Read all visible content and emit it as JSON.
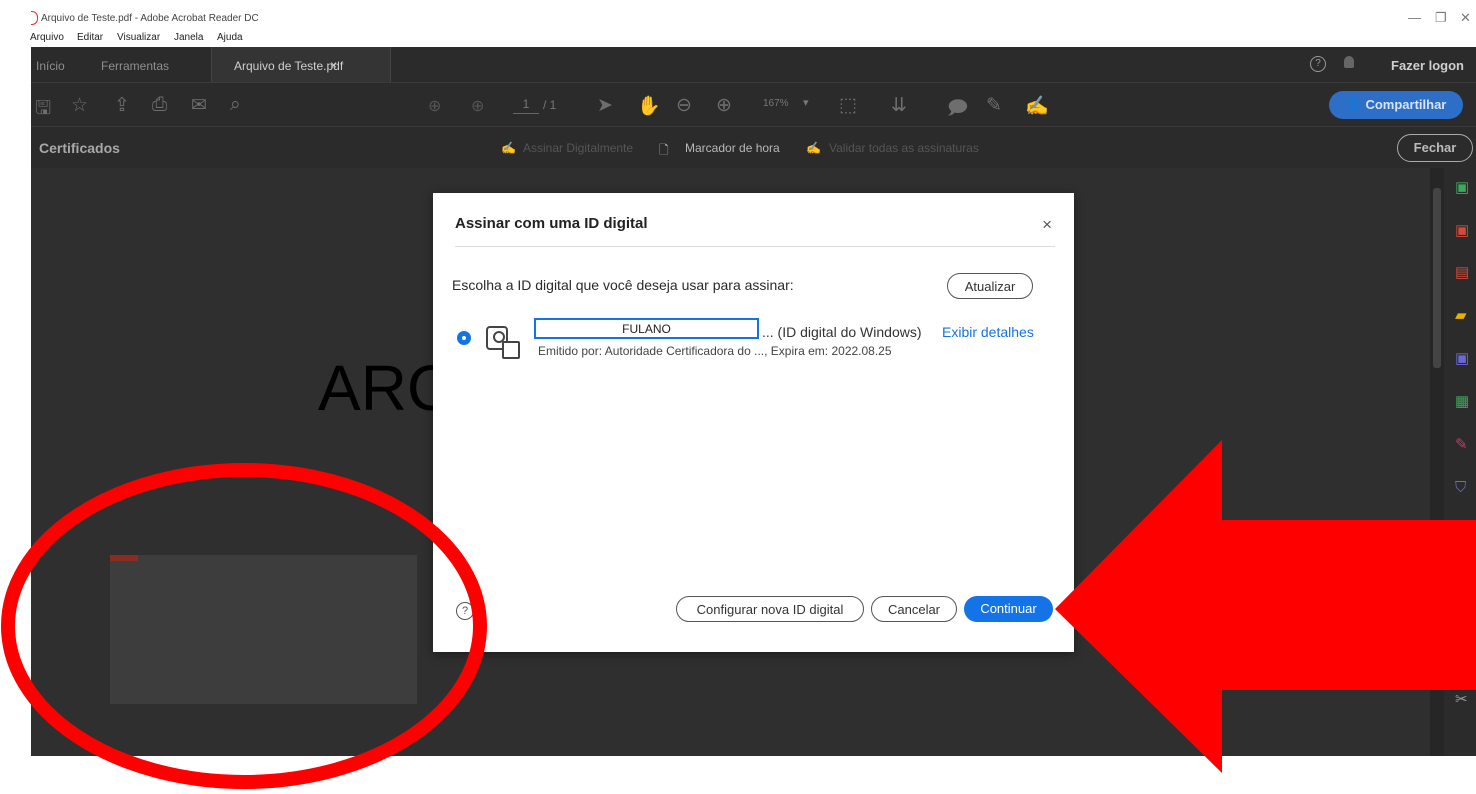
{
  "window": {
    "title": "Arquivo de Teste.pdf - Adobe Acrobat Reader DC",
    "minimize_glyph": "—",
    "restore_glyph": "❐",
    "close_glyph": "✕"
  },
  "menu": [
    "Arquivo",
    "Editar",
    "Visualizar",
    "Janela",
    "Ajuda"
  ],
  "tabs": {
    "inicio": "Início",
    "ferramentas": "Ferramentas",
    "document": "Arquivo de Teste.pdf",
    "document_close": "×",
    "login": "Fazer logon",
    "help_glyph": "?"
  },
  "toolbar": {
    "page_current": "1",
    "page_total": "/ 1",
    "zoom": "167%",
    "share": "Compartilhar"
  },
  "cert_bar": {
    "title": "Certificados",
    "sign": "Assinar Digitalmente",
    "timestamp": "Marcador de hora",
    "validate": "Validar todas as assinaturas",
    "close": "Fechar"
  },
  "document": {
    "visible_text": "ARC"
  },
  "dialog": {
    "title": "Assinar com uma ID digital",
    "close_glyph": "×",
    "prompt": "Escolha a ID digital que você deseja usar para assinar:",
    "refresh": "Atualizar",
    "id_name": "FULANO",
    "id_type": "... (ID digital do Windows)",
    "show_details": "Exibir detalhes",
    "issuer_line": "Emitido por: Autoridade Certificadora do ..., Expira em: 2022.08.25",
    "help_glyph": "?",
    "configure": "Configurar nova ID digital",
    "cancel": "Cancelar",
    "continue": "Continuar"
  },
  "colors": {
    "accent": "#1473e6",
    "share": "#2d6fc7",
    "annotation": "#ff0000",
    "chrome": "#2b2b2b",
    "canvas": "#2f2f2f"
  },
  "icons": {
    "toolbar": [
      "save-icon",
      "bookmark-star-icon",
      "upload-icon",
      "print-icon",
      "email-icon",
      "search-zoom-icon",
      "previous-page-icon",
      "next-page-icon",
      "select-cursor-icon",
      "hand-icon",
      "zoom-out-icon",
      "zoom-in-icon",
      "fit-page-icon",
      "scroll-mode-icon",
      "comment-icon",
      "highlight-pen-icon",
      "sign-icon"
    ],
    "right_rail": [
      "create-pdf-icon",
      "export-pdf-icon",
      "organize-pages-icon",
      "comment-tool-icon",
      "combine-files-icon",
      "edit-pdf-icon",
      "fill-sign-icon",
      "protect-icon",
      "acrobat-pdf-icon",
      "prepare-form-icon",
      "send-review-icon",
      "certificates-icon",
      "more-tools-icon"
    ]
  }
}
